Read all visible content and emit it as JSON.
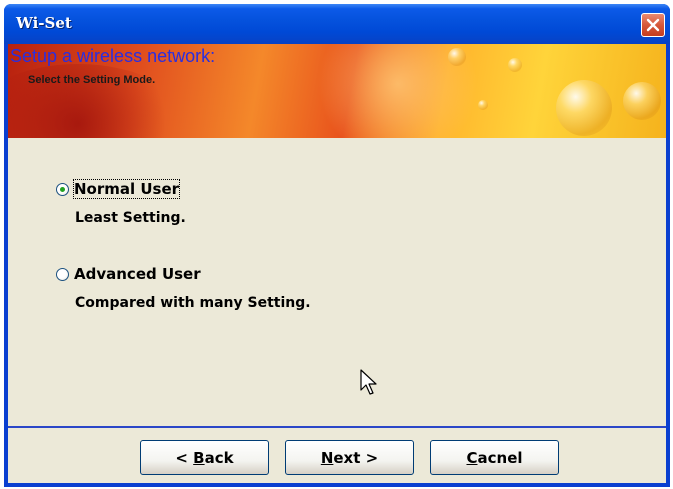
{
  "window": {
    "title": "Wi-Set"
  },
  "banner": {
    "title": "Setup a wireless network:",
    "subtitle": "Select the Setting Mode."
  },
  "options": [
    {
      "label": "Normal User",
      "description": "Least Setting.",
      "selected": true
    },
    {
      "label": "Advanced User",
      "description": "Compared with many Setting.",
      "selected": false
    }
  ],
  "buttons": {
    "back_prefix": "< ",
    "back_key": "B",
    "back_rest": "ack",
    "next_key": "N",
    "next_rest": "ext >",
    "cancel_key": "C",
    "cancel_rest": "acnel"
  },
  "colors": {
    "title_bar": "#0552dd",
    "client_bg": "#ece9d8",
    "banner_title": "#2a2ee0",
    "radio_selected": "#21a121",
    "close_button": "#d6583a"
  }
}
